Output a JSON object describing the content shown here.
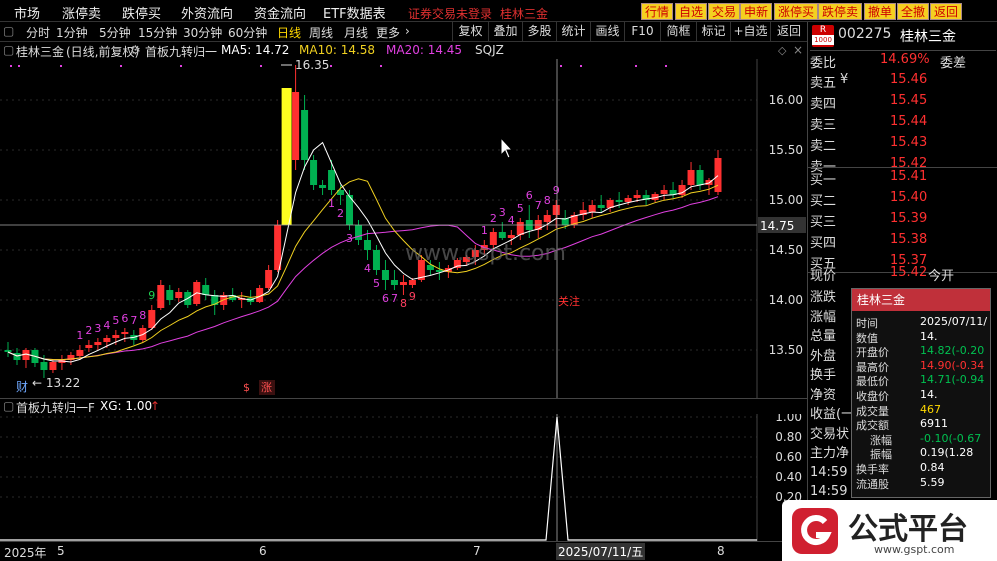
{
  "menu": {
    "items": [
      "市场",
      "涨停卖",
      "跌停买",
      "外资流向",
      "资金流向",
      "ETF数据表"
    ],
    "status": "证券交易未登录",
    "stock_name": "桂林三金"
  },
  "quick_buttons": [
    "行情",
    "自选",
    "交易",
    "申新",
    "涨停买",
    "跌停卖",
    "撤单",
    "全撤",
    "返回"
  ],
  "tabs": {
    "periods": [
      "分时",
      "1分钟",
      "5分钟",
      "15分钟",
      "30分钟",
      "60分钟",
      "日线",
      "周线",
      "月线",
      "更多"
    ],
    "selected": "日线",
    "buttons": [
      "复权",
      "叠加",
      "多股",
      "统计",
      "画线",
      "F10",
      "简框",
      "标记",
      "+自选",
      "返回"
    ]
  },
  "indicator": {
    "stock_label": "桂林三金",
    "mode": "(日线,前复权)",
    "formula": "首板九转归一",
    "ma5": "MA5: 14.72",
    "ma10": "MA10: 14.58",
    "ma20": "MA20: 14.45",
    "sqjz": "SQJZ"
  },
  "sub_indicator": {
    "formula": "首板九转归一F",
    "xg": "XG: 1.00"
  },
  "price_axis": {
    "labels": [
      "16.00",
      "15.50",
      "15.00",
      "14.50",
      "14.00",
      "13.50"
    ],
    "current": "14.75"
  },
  "sub_axis": {
    "labels": [
      "1.00",
      "0.80",
      "0.60",
      "0.40",
      "0.20"
    ]
  },
  "date_axis": {
    "labels": [
      "2025年",
      "5",
      "6",
      "7",
      "8"
    ],
    "cursor": "2025/07/11/五"
  },
  "annotations": {
    "high": "16.35",
    "low": "13.22",
    "watch": "关注",
    "cai": "财",
    "s": "$",
    "zhang": "涨"
  },
  "watermark": "www.gspt.com",
  "right_panel": {
    "code": "002275",
    "name": "桂林三金",
    "r_badge": "R",
    "r_sub": "1000",
    "weibi": {
      "label": "委比",
      "value": "14.69%",
      "extra": "委差"
    },
    "asks": [
      {
        "label": "卖五",
        "value": "15.46"
      },
      {
        "label": "卖四",
        "value": "15.45"
      },
      {
        "label": "卖三",
        "value": "15.44"
      },
      {
        "label": "卖二",
        "value": "15.43"
      },
      {
        "label": "卖一",
        "value": "15.42"
      }
    ],
    "bids": [
      {
        "label": "买一",
        "value": "15.41"
      },
      {
        "label": "买二",
        "value": "15.40"
      },
      {
        "label": "买三",
        "value": "15.39"
      },
      {
        "label": "买四",
        "value": "15.38"
      },
      {
        "label": "买五",
        "value": "15.37"
      }
    ],
    "yen": "¥",
    "current": {
      "label": "现价",
      "value": "15.42",
      "extra": "今开"
    },
    "others": [
      "涨跌",
      "涨幅",
      "总量",
      "外盘",
      "换手",
      "净资",
      "收益(一)",
      "交易状",
      "主力净"
    ],
    "times": [
      "14:59",
      "14:59"
    ]
  },
  "tooltip": {
    "title": "桂林三金",
    "rows": [
      {
        "label": "时间",
        "value": "2025/07/11/"
      },
      {
        "label": "数值",
        "value": "14."
      },
      {
        "label": "开盘价",
        "value": "14.82(-0.20"
      },
      {
        "label": "最高价",
        "value": "14.90(-0.34"
      },
      {
        "label": "最低价",
        "value": "14.71(-0.94"
      },
      {
        "label": "收盘价",
        "value": "14."
      },
      {
        "label": "成交量",
        "value": "467"
      },
      {
        "label": "成交额",
        "value": "6911"
      },
      {
        "label": "涨幅",
        "value": "-0.10(-0.67"
      },
      {
        "label": "振幅",
        "value": "0.19(1.28"
      },
      {
        "label": "换手率",
        "value": "0.84"
      },
      {
        "label": "流通股",
        "value": "5.59"
      }
    ]
  },
  "logo": {
    "name": "公式平台",
    "url": "www.gspt.com"
  },
  "colors": {
    "up": "#ff3030",
    "down": "#00b050",
    "ma5": "#ffffff",
    "ma10": "#f0d020",
    "ma20": "#e040e0",
    "accent": "#ffd800"
  }
}
